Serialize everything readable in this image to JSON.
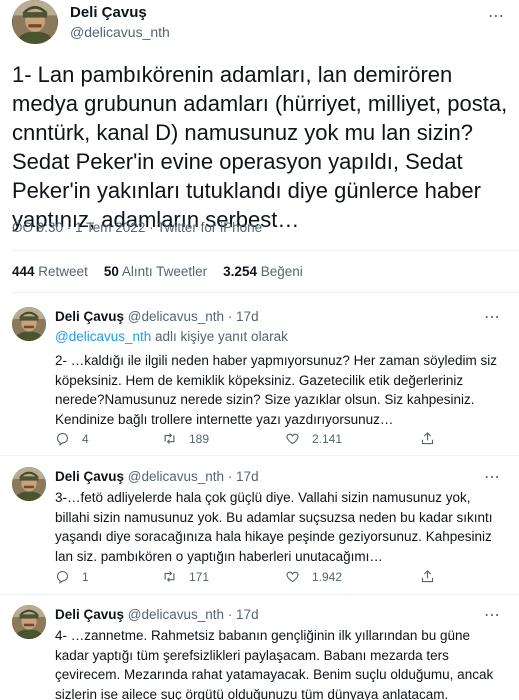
{
  "main_tweet": {
    "author_name": "Deli Çavuş",
    "author_handle": "@delicavus_nth",
    "more_icon": "⋯",
    "text": "1- Lan pambıkörenin adamları, lan demirören medya grubunun adamları (hürriyet, milliyet, posta, cnntürk, kanal D) namusunuz yok mu lan sizin? Sedat Peker'in evine operasyon yapıldı, Sedat Peker'in yakınları tutuklandı diye günlerce haber yaptınız, adamların serbest…",
    "meta": "ÖÖ 9:30 · 1 Tem 2022 · Twitter for iPhone",
    "stats": {
      "retweets_count": "444",
      "retweets_label": "Retweet",
      "quotes_count": "50",
      "quotes_label": "Alıntı Tweetler",
      "likes_count": "3.254",
      "likes_label": "Beğeni"
    }
  },
  "replies": [
    {
      "author_name": "Deli Çavuş",
      "author_handle": "@delicavus_nth · 17d",
      "replying_to_handle": "@delicavus_nth",
      "replying_to_suffix": " adlı kişiye yanıt olarak",
      "text": "2- …kaldığı ile ilgili neden haber yapmıyorsunuz? Her zaman söyledim siz köpeksiniz. Hem de kemiklik köpeksiniz. Gazetecilik etik değerleriniz nerede?Namusunuz nerede sizin? Size yazıklar olsun. Siz kahpesiniz. Kendinize bağlı trollere internette yazı yazdırıyorsunuz…",
      "replies_count": "4",
      "retweets_count": "189",
      "likes_count": "2.141"
    },
    {
      "author_name": "Deli Çavuş",
      "author_handle": "@delicavus_nth · 17d",
      "text": "3-…fetö adliyelerde hala çok güçlü diye. Vallahi sizin namusunuz yok, billahi sizin namusunuz yok. Bu adamlar suçsuzsa neden bu kadar sıkıntı yaşandı diye soracağınıza hala hikaye peşinde geziyorsunuz. Kahpesiniz lan siz. pambıkören o yaptığın haberleri unutacağımı…",
      "replies_count": "1",
      "retweets_count": "171",
      "likes_count": "1.942"
    },
    {
      "author_name": "Deli Çavuş",
      "author_handle": "@delicavus_nth · 17d",
      "text": "4- …zannetme. Rahmetsiz babanın gençliğinin ilk yıllarından bu güne kadar yaptığı tüm şerefsizlikleri paylaşacam. Babanı mezarda ters çevirecem. Mezarında rahat yatamayacak. Benim suçlu olduğumu, ancak sizlerin ise ailece suç örgütü olduğunuzu tüm dünyaya anlatacam."
    }
  ],
  "colors": {
    "text": "#0f1419",
    "secondary": "#536471",
    "link": "#1d9bf0",
    "divider": "#eff3f4"
  },
  "icons": [
    "more-icon",
    "reply-icon",
    "retweet-icon",
    "like-icon",
    "share-icon"
  ]
}
